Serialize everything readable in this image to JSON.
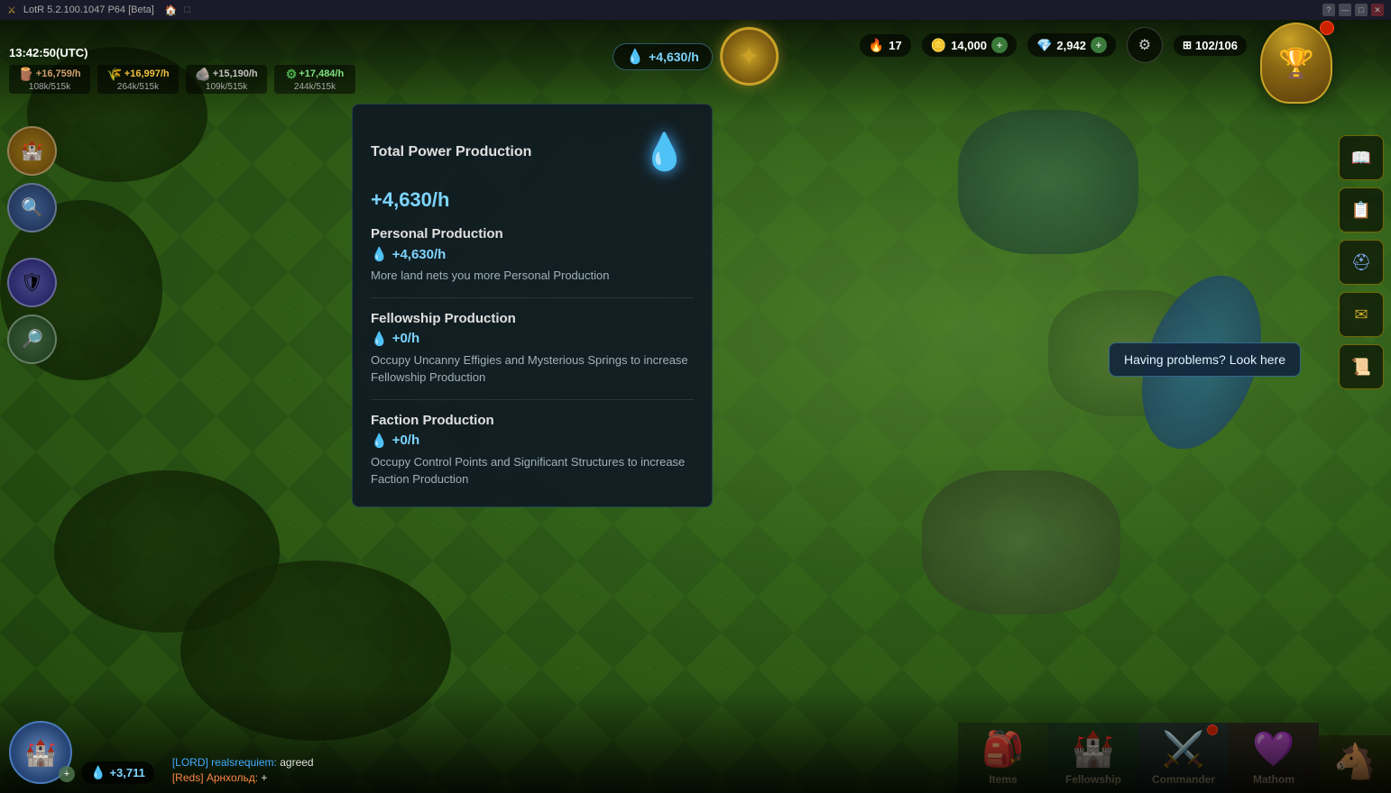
{
  "window": {
    "title": "LotR 5.2.100.1047 P64 [Beta]",
    "controls": [
      "minimize",
      "maximize",
      "close"
    ]
  },
  "topbar": {
    "time": "13:42:50(UTC)",
    "resources": [
      {
        "icon": "wood",
        "rate": "+16,759/h",
        "current": "108k/515k",
        "color": "#b8763a"
      },
      {
        "icon": "food",
        "rate": "+16,997/h",
        "current": "264k/515k",
        "color": "#D4A017"
      },
      {
        "icon": "stone",
        "rate": "+15,190/h",
        "current": "109k/515k",
        "color": "#9E9E9E"
      },
      {
        "icon": "ore",
        "rate": "+17,484/h",
        "current": "244k/515k",
        "color": "#4CAF50"
      }
    ],
    "power_rate": "+4,630/h",
    "fires": "17",
    "gold": "14,000",
    "gems": "2,942",
    "tiles": "102/106"
  },
  "power_popup": {
    "title": "Total Power Production",
    "total_value": "+4,630/h",
    "sections": [
      {
        "title": "Personal Production",
        "value": "+4,630/h",
        "description": "More land nets you more Personal Production"
      },
      {
        "title": "Fellowship Production",
        "value": "+0/h",
        "description": "Occupy Uncanny Effigies and Mysterious Springs to increase Fellowship Production"
      },
      {
        "title": "Faction Production",
        "value": "+0/h",
        "description": "Occupy Control Points and Significant Structures to increase Faction Production"
      }
    ]
  },
  "tooltip": {
    "text": "Having problems? Look here"
  },
  "bottom_left": {
    "power_value": "+3,711"
  },
  "chat": {
    "messages": [
      {
        "type": "lord",
        "sender": "[LORD] realsrequiem:",
        "text": "agreed"
      },
      {
        "type": "reds",
        "sender": "[Reds] Арнхольд:",
        "text": "+"
      }
    ]
  },
  "nav_tabs": [
    {
      "id": "items",
      "label": "Items",
      "icon": "🎒",
      "has_badge": false
    },
    {
      "id": "fellowship",
      "label": "Fellowship",
      "icon": "🏰",
      "has_badge": false
    },
    {
      "id": "commander",
      "label": "Commander",
      "icon": "⚔️",
      "has_badge": false
    },
    {
      "id": "mathom",
      "label": "Mathom",
      "icon": "💎",
      "has_badge": false
    },
    {
      "id": "horse",
      "label": "",
      "icon": "🐴",
      "has_badge": false
    }
  ],
  "right_sidebar": {
    "buttons": [
      {
        "id": "book",
        "icon": "📖"
      },
      {
        "id": "scroll",
        "icon": "📋"
      },
      {
        "id": "mail",
        "icon": "✉️"
      },
      {
        "id": "quest",
        "icon": "📜"
      }
    ]
  }
}
